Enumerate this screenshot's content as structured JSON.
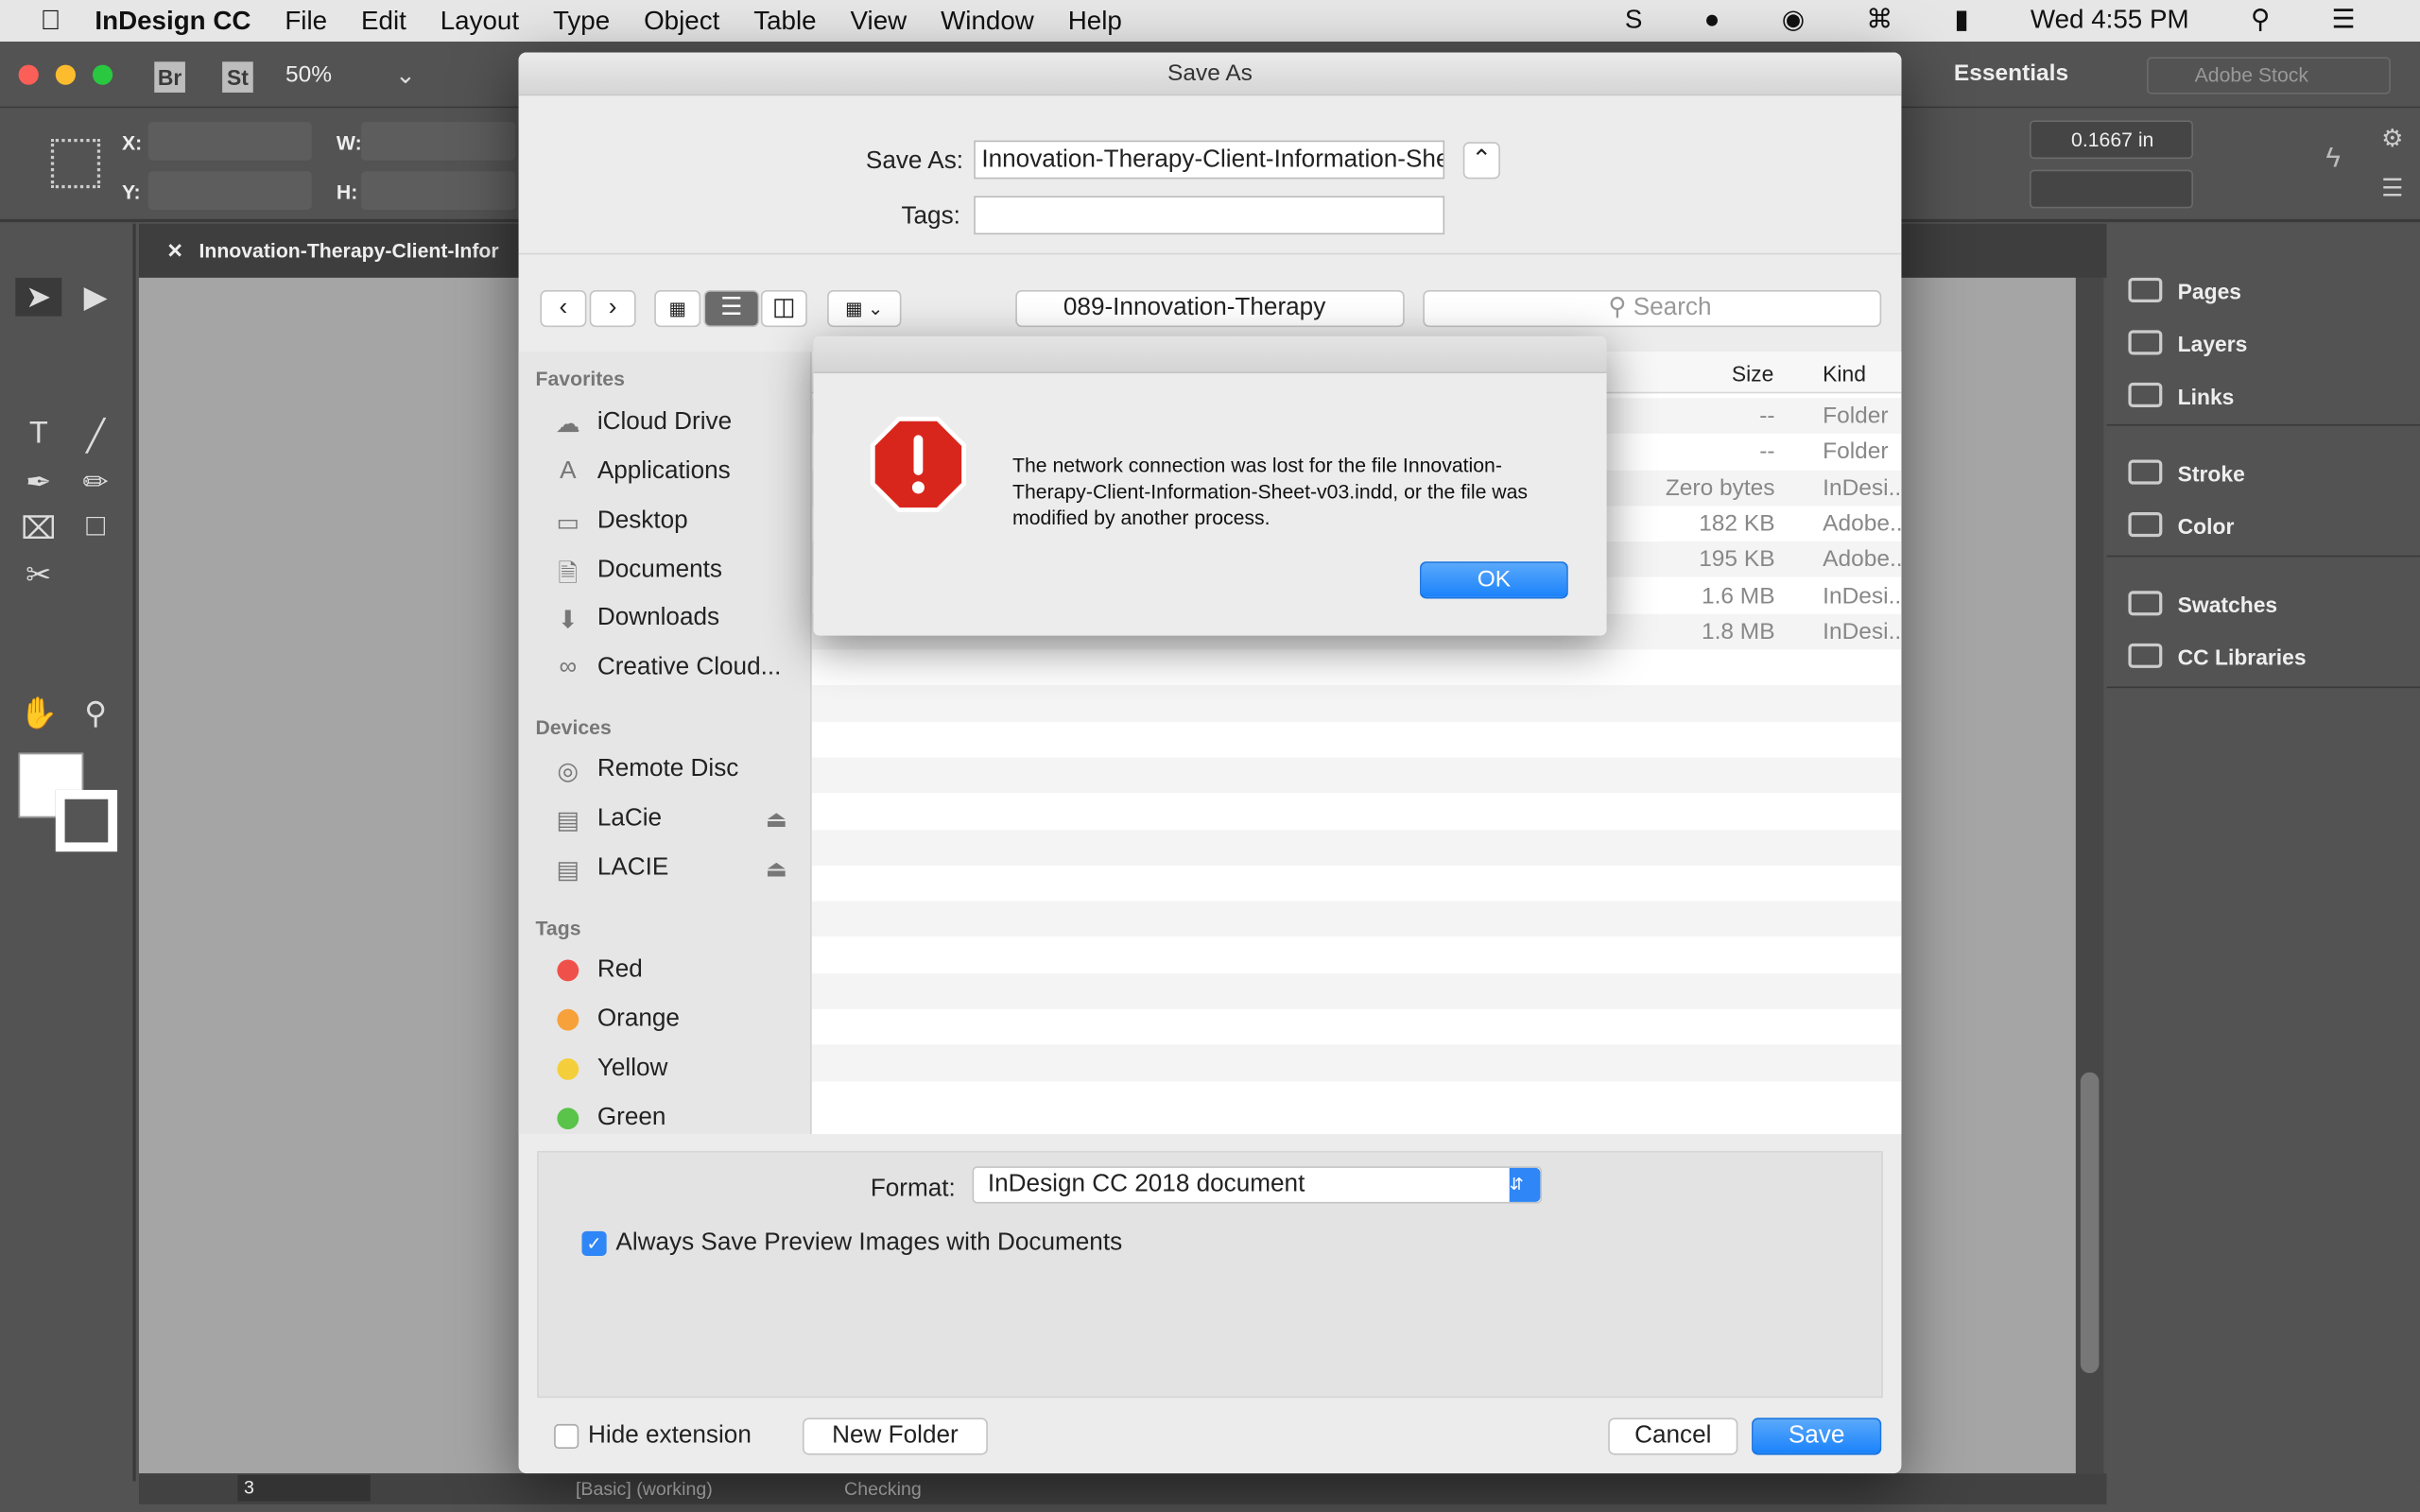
{
  "menubar": {
    "app": "InDesign CC",
    "items": [
      "File",
      "Edit",
      "Layout",
      "Type",
      "Object",
      "Table",
      "View",
      "Window",
      "Help"
    ],
    "clock": "Wed 4:55 PM"
  },
  "appbar": {
    "bridge": "Br",
    "stock": "St",
    "zoom": "50%",
    "workspace": "Essentials",
    "search_placeholder": "Adobe Stock"
  },
  "control": {
    "x_label": "X:",
    "y_label": "Y:",
    "w_label": "W:",
    "h_label": "H:",
    "gutter": "0.1667 in"
  },
  "tab": {
    "title": "Innovation-Therapy-Client-Infor"
  },
  "panels": [
    "Pages",
    "Layers",
    "Links",
    "Stroke",
    "Color",
    "Swatches",
    "CC Libraries"
  ],
  "status": {
    "page": "3",
    "style": "[Basic] (working)",
    "preflight": "Checking"
  },
  "dialog": {
    "title": "Save As",
    "save_as_label": "Save As:",
    "filename": "Innovation-Therapy-Client-Information-Sheet-v03.indd",
    "tags_label": "Tags:",
    "folder": "089-Innovation-Therapy",
    "search_placeholder": "Search",
    "sidebar": {
      "favorites_header": "Favorites",
      "favorites": [
        "iCloud Drive",
        "Applications",
        "Desktop",
        "Documents",
        "Downloads",
        "Creative Cloud..."
      ],
      "devices_header": "Devices",
      "devices": [
        "Remote Disc",
        "LaCie",
        "LACIE"
      ],
      "tags_header": "Tags",
      "tags": [
        {
          "name": "Red",
          "color": "#f0504a"
        },
        {
          "name": "Orange",
          "color": "#f7a13a"
        },
        {
          "name": "Yellow",
          "color": "#f5cf3b"
        },
        {
          "name": "Green",
          "color": "#5ac34a"
        }
      ]
    },
    "columns": {
      "size": "Size",
      "kind": "Kind"
    },
    "rows": [
      {
        "size": "--",
        "kind": "Folder"
      },
      {
        "size": "--",
        "kind": "Folder"
      },
      {
        "size": "Zero bytes",
        "kind": "InDesi..."
      },
      {
        "size": "182 KB",
        "kind": "Adobe..."
      },
      {
        "size": "195 KB",
        "kind": "Adobe..."
      },
      {
        "size": "1.6 MB",
        "kind": "InDesi..."
      },
      {
        "size": "1.8 MB",
        "kind": "InDesi..."
      }
    ],
    "format_label": "Format:",
    "format": "InDesign CC 2018 document",
    "preview_label": "Always Save Preview Images with Documents",
    "preview_checked": true,
    "hide_ext_label": "Hide extension",
    "new_folder": "New Folder",
    "cancel": "Cancel",
    "save": "Save"
  },
  "alert": {
    "message": "The network connection was lost for the file Innovation-Therapy-Client-Information-Sheet-v03.indd, or the file was modified by another process.",
    "ok": "OK"
  }
}
